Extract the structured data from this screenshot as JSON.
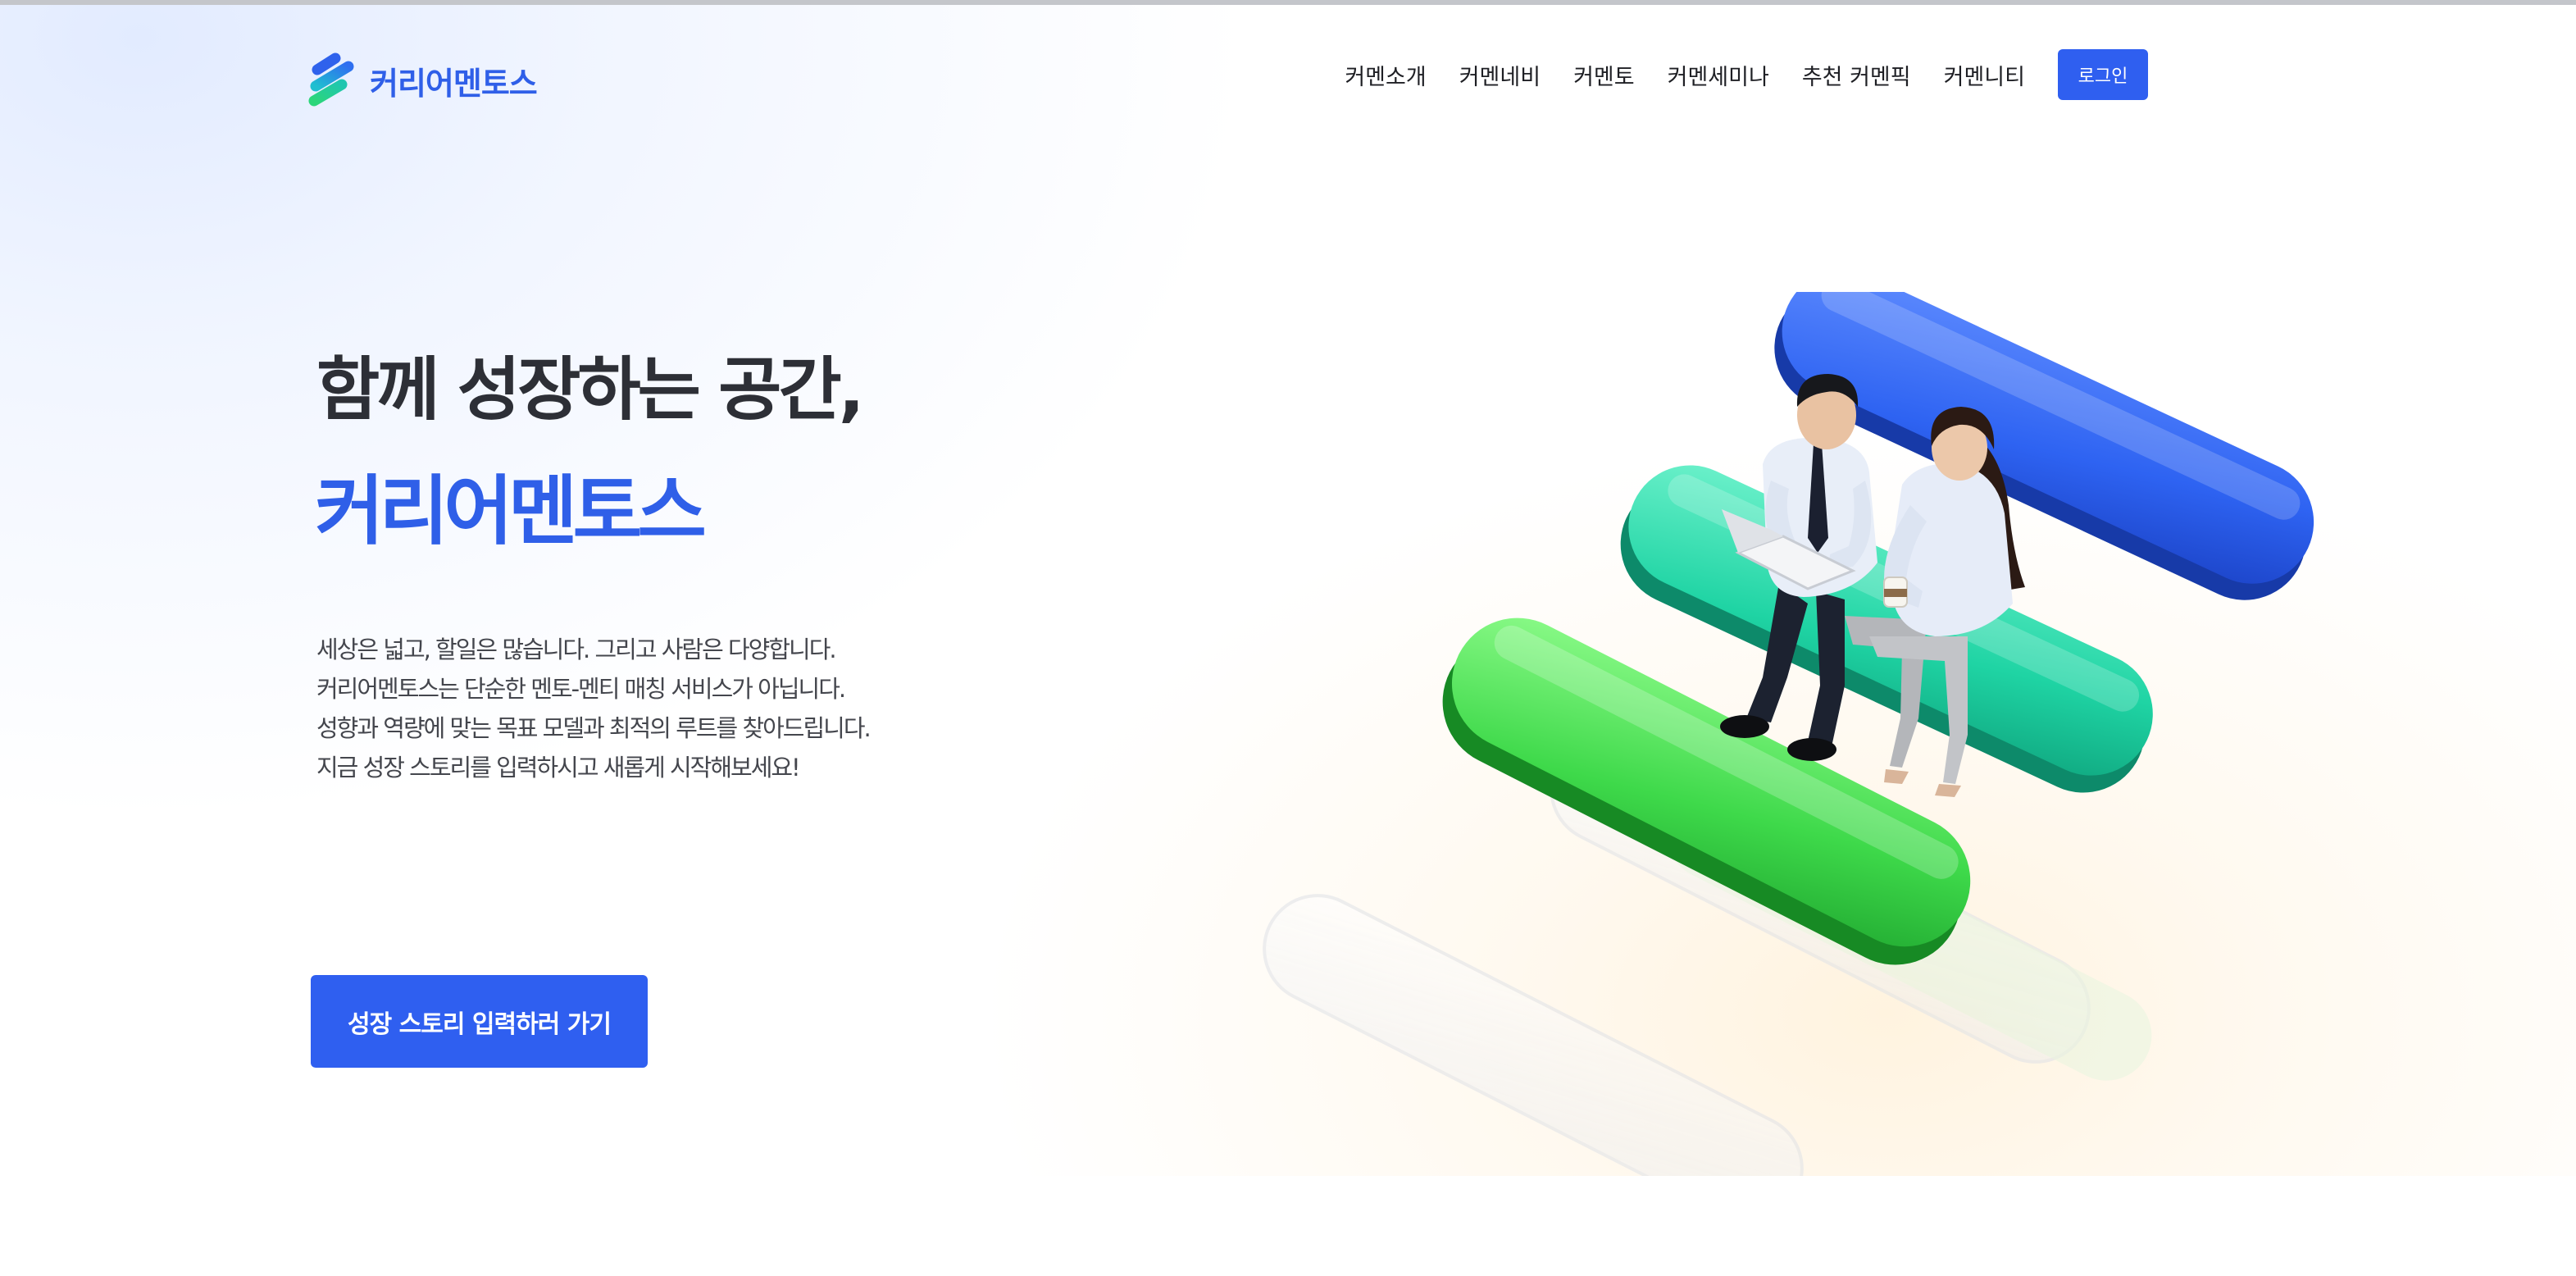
{
  "header": {
    "logo_text": "커리어멘토스",
    "logo_icon": "stripes-logo-icon",
    "nav_items": [
      "커멘소개",
      "커멘네비",
      "커멘토",
      "커멘세미나",
      "추천 커멘픽",
      "커멘니티"
    ],
    "login_label": "로그인"
  },
  "hero": {
    "headline": "함께 성장하는 공간,",
    "brand_title": "커리어멘토스",
    "description_lines": [
      "세상은 넓고, 할일은 많습니다. 그리고 사람은 다양합니다.",
      "커리어멘토스는 단순한 멘토-멘티 매칭 서비스가 아닙니다.",
      "성향과 역량에 맞는 목표 모델과 최적의 루트를 찾아드립니다.",
      "지금 성장 스토리를 입력하시고 새롭게 시작해보세요!"
    ],
    "cta_label": "성장 스토리 입력하러 가기",
    "illustration": "mentoring-people-on-pills-image"
  },
  "colors": {
    "accent": "#2f5ff0",
    "brand_text": "#2f5fe8",
    "pill_blue": "#2e63f2",
    "pill_teal": "#1fd4a4",
    "pill_green": "#3ed94a"
  }
}
